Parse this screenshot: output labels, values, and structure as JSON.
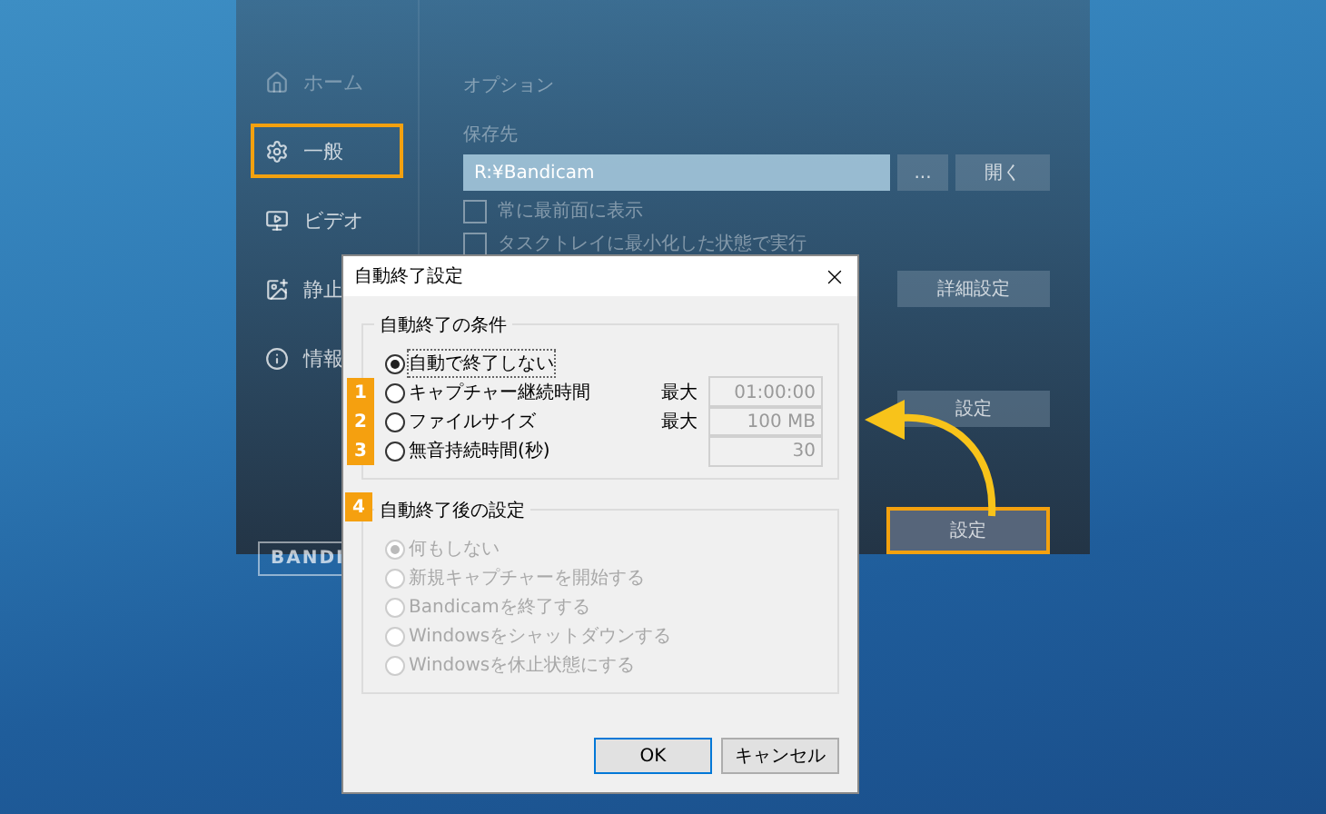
{
  "app": {
    "sidebar": [
      {
        "label": "ホーム",
        "highlighted": false
      },
      {
        "label": "一般",
        "highlighted": true
      },
      {
        "label": "ビデオ",
        "highlighted": false
      },
      {
        "label": "静止",
        "highlighted": false
      },
      {
        "label": "情報",
        "highlighted": false
      }
    ],
    "logo": "BANDI",
    "section": "オプション",
    "save_label": "保存先",
    "save_path": "R:¥Bandicam",
    "browse_button": "...",
    "open_button": "開く",
    "options": [
      {
        "label": "常に最前面に表示",
        "checked": false
      },
      {
        "label": "タスクトレイに最小化した状態で実行",
        "checked": false
      }
    ],
    "advanced_button": "詳細設定",
    "settings_buttons": [
      {
        "label": "設定",
        "highlighted": false
      },
      {
        "label": "設定",
        "highlighted": true
      }
    ]
  },
  "dialog": {
    "title": "自動終了設定",
    "condition_group": {
      "title": "自動終了の条件",
      "options": [
        {
          "label": "自動で終了しない",
          "selected": true
        },
        {
          "label": "キャプチャー継続時間",
          "selected": false,
          "badge": "1",
          "max_label": "最大",
          "value": "01:00:00"
        },
        {
          "label": "ファイルサイズ",
          "selected": false,
          "badge": "2",
          "max_label": "最大",
          "value": "100 MB"
        },
        {
          "label": "無音持続時間(秒)",
          "selected": false,
          "badge": "3",
          "value": "30"
        }
      ]
    },
    "after_group": {
      "title": "自動終了後の設定",
      "badge": "4",
      "disabled": true,
      "options": [
        {
          "label": "何もしない",
          "selected": true
        },
        {
          "label": "新規キャプチャーを開始する",
          "selected": false
        },
        {
          "label": "Bandicamを終了する",
          "selected": false
        },
        {
          "label": "Windowsをシャットダウンする",
          "selected": false
        },
        {
          "label": "Windowsを休止状態にする",
          "selected": false
        }
      ]
    },
    "buttons": [
      {
        "label": "OK",
        "default": true
      },
      {
        "label": "キャンセル",
        "default": false
      }
    ]
  }
}
